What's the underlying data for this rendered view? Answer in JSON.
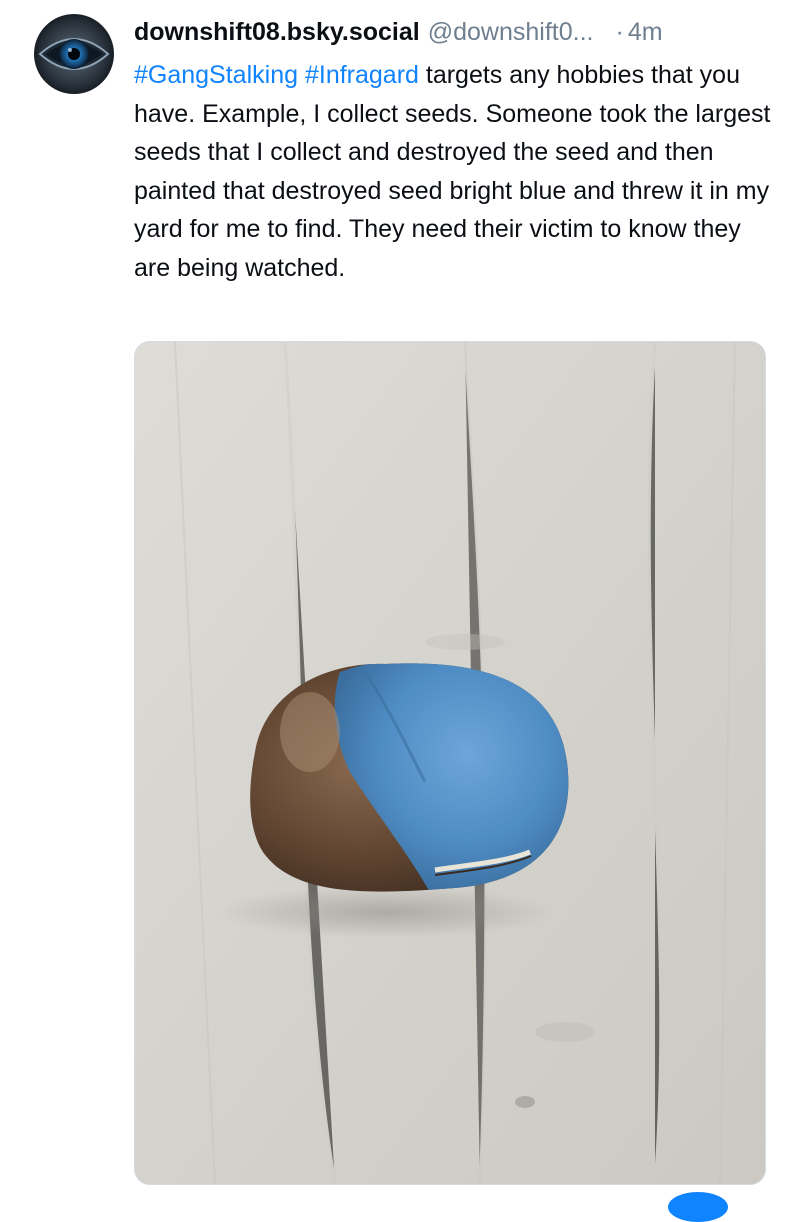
{
  "post": {
    "author": {
      "display_name": "downshift08.bsky.social",
      "handle": "@downshift0...",
      "avatar_icon": "eye-avatar-icon"
    },
    "separator": "·",
    "timestamp": "4m",
    "text": {
      "hashtag_1": "#GangStalking",
      "space": " ",
      "hashtag_2": "#Infragard",
      "body": " targets any hobbies that you have. Example, I collect seeds. Someone took the largest seeds that I collect and destroyed the seed and then painted that destroyed seed bright blue and threw it in my yard for me to find. They need their victim to know they are being watched."
    },
    "media": {
      "type": "photo",
      "subject_icon": "blue-painted-seed-photo"
    }
  },
  "colors": {
    "hashtag": "#1083fe",
    "meta_text": "#6f7f8f",
    "primary_text": "#0b0f14",
    "image_border": "#d4dbe2"
  }
}
